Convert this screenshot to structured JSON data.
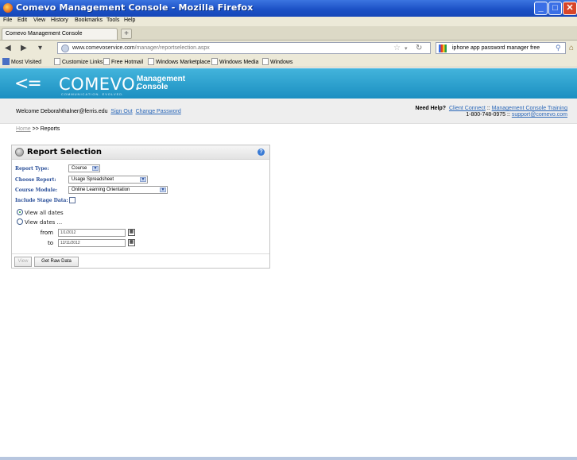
{
  "window": {
    "title": "Comevo Management Console - Mozilla Firefox"
  },
  "menu": [
    "File",
    "Edit",
    "View",
    "History",
    "Bookmarks",
    "Tools",
    "Help"
  ],
  "tab": {
    "label": "Comevo Management Console",
    "new_tab": "+"
  },
  "nav": {
    "url_domain": "www.comevoservice.com",
    "url_path": "/manager/reportselection.aspx",
    "search_value": "iphone app password manager free"
  },
  "bookmarks": [
    "Most Visited",
    "Customize Links",
    "Free Hotmail",
    "Windows Marketplace",
    "Windows Media",
    "Windows"
  ],
  "banner": {
    "logo_chevrons": "<=",
    "logo_word": "COMEVO.",
    "logo_tag": "COMMUNICATION. EVOLVED.",
    "title_line1": "Management",
    "title_line2": "Console"
  },
  "welcome": {
    "text": "Welcome Deborahthalner@ferris.edu",
    "sign_out": "Sign Out",
    "change_password": "Change Password"
  },
  "help": {
    "need_help": "Need Help?",
    "client_connect": "Client Connect",
    "sep1": " :: ",
    "training": "Management Console Training",
    "phone": "1-800-748-0975",
    "sep2": " :: ",
    "email": "support@comevo.com"
  },
  "breadcrumb": {
    "home": "Home",
    "current": " >> Reports"
  },
  "panel": {
    "title": "Report Selection",
    "help": "?",
    "report_type_label": "Report Type:",
    "report_type_value": "Course",
    "choose_report_label": "Choose Report:",
    "choose_report_value": "Usage Spreadsheet",
    "course_module_label": "Course Module:",
    "course_module_value": "Online Learning Orientation",
    "include_stage_label": "Include Stage Data:",
    "include_stage_checked": false,
    "view_all": "View all dates",
    "view_dates": "View dates ...",
    "from_label": "from",
    "from_value": "1/1/2012",
    "to_label": "to",
    "to_value": "12/11/2012",
    "view_button": "View",
    "raw_button": "Get Raw Data"
  },
  "colors": {
    "banner": "#1b8fc1",
    "link": "#2a67b8",
    "label": "#2a4f99"
  }
}
